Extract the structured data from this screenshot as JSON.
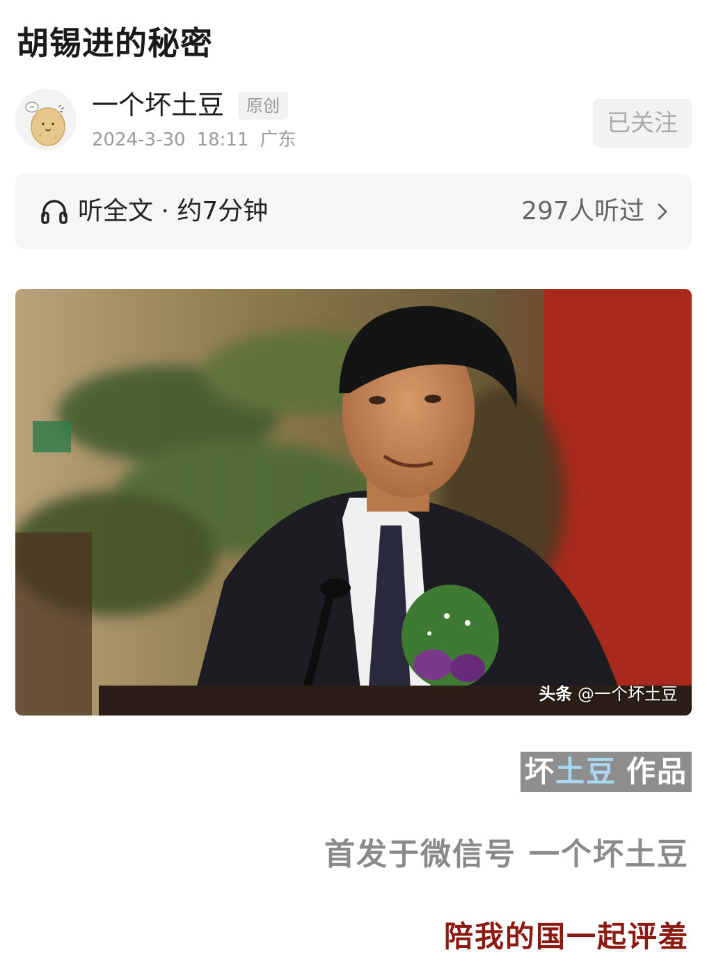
{
  "article": {
    "title": "胡锡进的秘密"
  },
  "author": {
    "name": "一个坏土豆",
    "badge": "原创",
    "date": "2024-3-30",
    "time": "18:11",
    "location": "广东",
    "follow_label": "已关注"
  },
  "listen": {
    "label": "听全文 · 约7分钟",
    "count": "297人听过",
    "icon": "headphones-icon",
    "chevron": "chevron-right-icon"
  },
  "photo": {
    "watermark_brand": "头条",
    "watermark_handle": "@一个坏土豆"
  },
  "body": {
    "work_tag": {
      "part1": "坏",
      "part2": "土豆",
      "part3": "作品"
    },
    "published_prefix": "首发于微信号",
    "published_account": "一个坏土豆",
    "slogan": "陪我的国一起评羞"
  },
  "colors": {
    "slogan_red": "#8b1a12",
    "tag_bg": "#8e8e8e",
    "tag_highlight": "#a9d8f5",
    "muted_gray": "#9a9a9a"
  }
}
